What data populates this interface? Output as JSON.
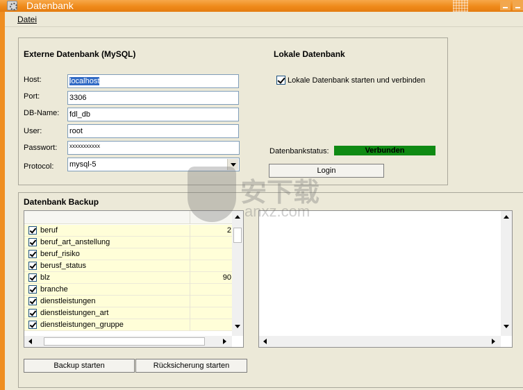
{
  "window": {
    "title": "Datenbank"
  },
  "menu": {
    "file": "Datei"
  },
  "external_db": {
    "heading": "Externe Datenbank (MySQL)",
    "host_label": "Host:",
    "host_value": "localhost",
    "port_label": "Port:",
    "port_value": "3306",
    "dbname_label": "DB-Name:",
    "dbname_value": "fdl_db",
    "user_label": "User:",
    "user_value": "root",
    "password_label": "Passwort:",
    "password_value": "xxxxxxxxxxx",
    "protocol_label": "Protocol:",
    "protocol_value": "mysql-5"
  },
  "local_db": {
    "heading": "Lokale Datenbank",
    "checkbox_label": "Lokale Datenbank starten und verbinden",
    "checkbox_checked": true,
    "status_label": "Datenbankstatus:",
    "status_value": "Verbunden",
    "status_color": "#0f8a13",
    "login_button": "Login"
  },
  "backup": {
    "heading": "Datenbank Backup",
    "tables": [
      {
        "name": "beruf",
        "size": "2",
        "checked": true
      },
      {
        "name": "beruf_art_anstellung",
        "size": "",
        "checked": true
      },
      {
        "name": "beruf_risiko",
        "size": "",
        "checked": true
      },
      {
        "name": "berusf_status",
        "size": "",
        "checked": true
      },
      {
        "name": "blz",
        "size": "90",
        "checked": true
      },
      {
        "name": "branche",
        "size": "",
        "checked": true
      },
      {
        "name": "dienstleistungen",
        "size": "",
        "checked": true
      },
      {
        "name": "dienstleistungen_art",
        "size": "",
        "checked": true
      },
      {
        "name": "dienstleistungen_gruppe",
        "size": "",
        "checked": true
      }
    ],
    "backup_button": "Backup starten",
    "restore_button": "Rücksicherung  starten"
  },
  "watermark": {
    "text": "安下载",
    "sub": "anxz.com"
  },
  "colors": {
    "titlebar": "#ef8a1a",
    "status_connected": "#0f8a13",
    "selection": "#316ac5"
  }
}
